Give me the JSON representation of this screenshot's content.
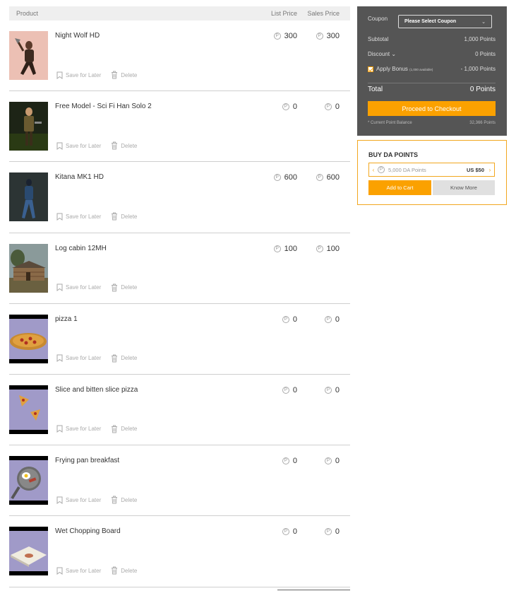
{
  "cart": {
    "header": {
      "product": "Product",
      "list_price": "List Price",
      "sales_price": "Sales Price"
    },
    "actions": {
      "save_label": "Save for Later",
      "delete_label": "Delete"
    },
    "items": [
      {
        "name": "Night Wolf HD",
        "list_price": "300",
        "sales_price": "300",
        "thumb_icon": "warrior-figure-thumbnail"
      },
      {
        "name": "Free Model - Sci Fi Han Solo 2",
        "list_price": "0",
        "sales_price": "0",
        "thumb_icon": "sci-fi-figure-thumbnail"
      },
      {
        "name": "Kitana MK1 HD",
        "list_price": "600",
        "sales_price": "600",
        "thumb_icon": "female-figure-thumbnail"
      },
      {
        "name": "Log cabin 12MH",
        "list_price": "100",
        "sales_price": "100",
        "thumb_icon": "log-cabin-thumbnail"
      },
      {
        "name": "pizza 1",
        "list_price": "0",
        "sales_price": "0",
        "thumb_icon": "pizza-thumbnail"
      },
      {
        "name": "Slice and bitten slice pizza",
        "list_price": "0",
        "sales_price": "0",
        "thumb_icon": "pizza-slices-thumbnail"
      },
      {
        "name": "Frying pan breakfast",
        "list_price": "0",
        "sales_price": "0",
        "thumb_icon": "frying-pan-thumbnail"
      },
      {
        "name": "Wet Chopping Board",
        "list_price": "0",
        "sales_price": "0",
        "thumb_icon": "chopping-board-thumbnail"
      }
    ]
  },
  "summary": {
    "coupon_label": "Coupon",
    "coupon_select": "Please Select Coupon",
    "subtotal_label": "Subtotal",
    "subtotal_value": "1,000 Points",
    "discount_label": "Discount",
    "discount_value": "0 Points",
    "bonus_label": "Apply Bonus",
    "bonus_note": "(1,000 available)",
    "bonus_value": "- 1,000 Points",
    "total_label": "Total",
    "total_value": "0 Points",
    "checkout_label": "Proceed to Checkout",
    "balance_label": "* Current Point Balance",
    "balance_value": "32,366 Points"
  },
  "buy_points": {
    "title": "BUY DA POINTS",
    "points_option": "5,000 DA Points",
    "price": "US $50",
    "add_to_cart_label": "Add to Cart",
    "know_more_label": "Know More"
  },
  "colors": {
    "accent": "#fba100",
    "panel": "#555555",
    "border": "#f2a71f"
  }
}
